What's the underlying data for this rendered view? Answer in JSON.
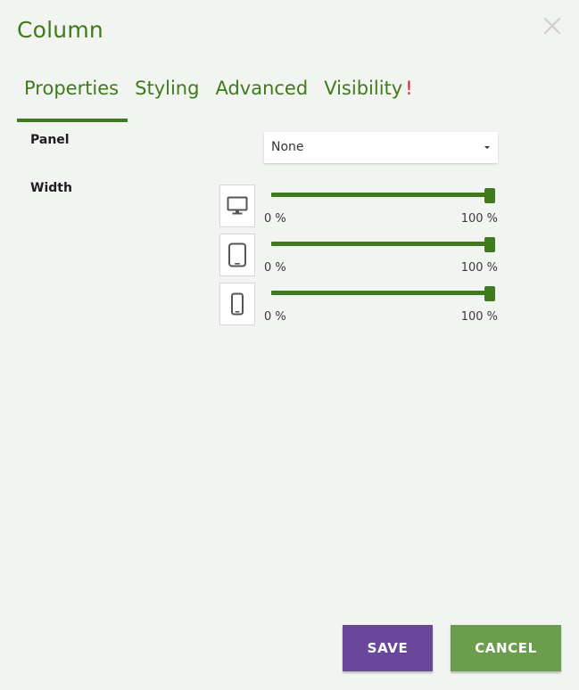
{
  "dialog": {
    "title": "Column",
    "close_icon": "close-icon"
  },
  "tabs": [
    {
      "label": "Properties",
      "active": true
    },
    {
      "label": "Styling",
      "active": false
    },
    {
      "label": "Advanced",
      "active": false
    },
    {
      "label": "Visibility",
      "active": false,
      "warning": "!"
    }
  ],
  "panel": {
    "label": "Panel",
    "selected": "None"
  },
  "width": {
    "label": "Width",
    "devices": [
      {
        "icon": "desktop-icon",
        "min_label": "0 %",
        "max_label": "100 %",
        "value_percent": 100
      },
      {
        "icon": "tablet-icon",
        "min_label": "0 %",
        "max_label": "100 %",
        "value_percent": 100
      },
      {
        "icon": "phone-icon",
        "min_label": "0 %",
        "max_label": "100 %",
        "value_percent": 100
      }
    ]
  },
  "buttons": {
    "save": "Save",
    "cancel": "Cancel"
  },
  "colors": {
    "accent_green": "#3f7a1c",
    "save_purple": "#69479b",
    "cancel_green": "#6a9d4d",
    "warning_red": "#e0201a"
  }
}
